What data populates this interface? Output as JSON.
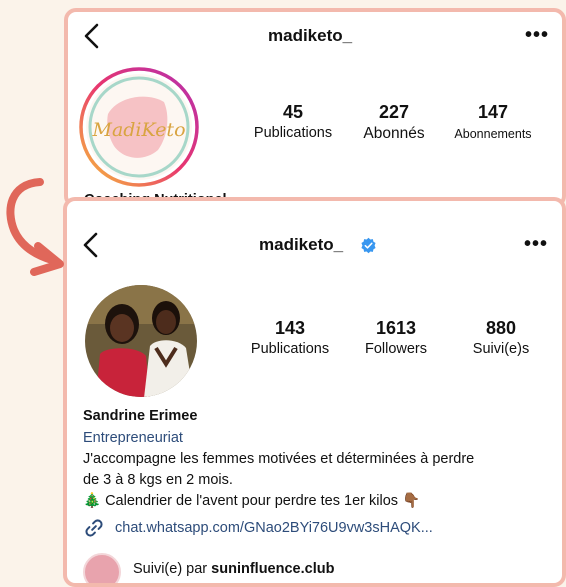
{
  "profile_old": {
    "username": "madiketo_",
    "logo_text": "MadiKeto",
    "stats": [
      {
        "value": "45",
        "label": "Publications"
      },
      {
        "value": "227",
        "label": "Abonnés"
      },
      {
        "value": "147",
        "label": "Abonnements"
      }
    ],
    "bio_name_partial": "Coaching Nutritionel"
  },
  "profile_new": {
    "username": "madiketo_",
    "verified": true,
    "stats": [
      {
        "value": "143",
        "label": "Publications"
      },
      {
        "value": "1613",
        "label": "Followers"
      },
      {
        "value": "880",
        "label": "Suivi(e)s"
      }
    ],
    "name": "Sandrine Erimee",
    "category": "Entrepreneuriat",
    "bio_line1": "J'accompagne les femmes motivées et déterminées à perdre",
    "bio_line2": "de 3 à 8 kgs en 2 mois.",
    "bio_line3": "🎄 Calendrier de l'avent pour perdre tes 1er kilos 👇🏾",
    "link": "chat.whatsapp.com/GNao2BYi76U9vw3sHAQK...",
    "followed_by_prefix": "Suivi(e) par",
    "followed_by_user": "suninfluence.club"
  },
  "colors": {
    "accent_border": "#f3b9ad",
    "link_blue": "#2d4c7a",
    "verified_blue": "#3897f0",
    "arrow": "#e0675a"
  }
}
